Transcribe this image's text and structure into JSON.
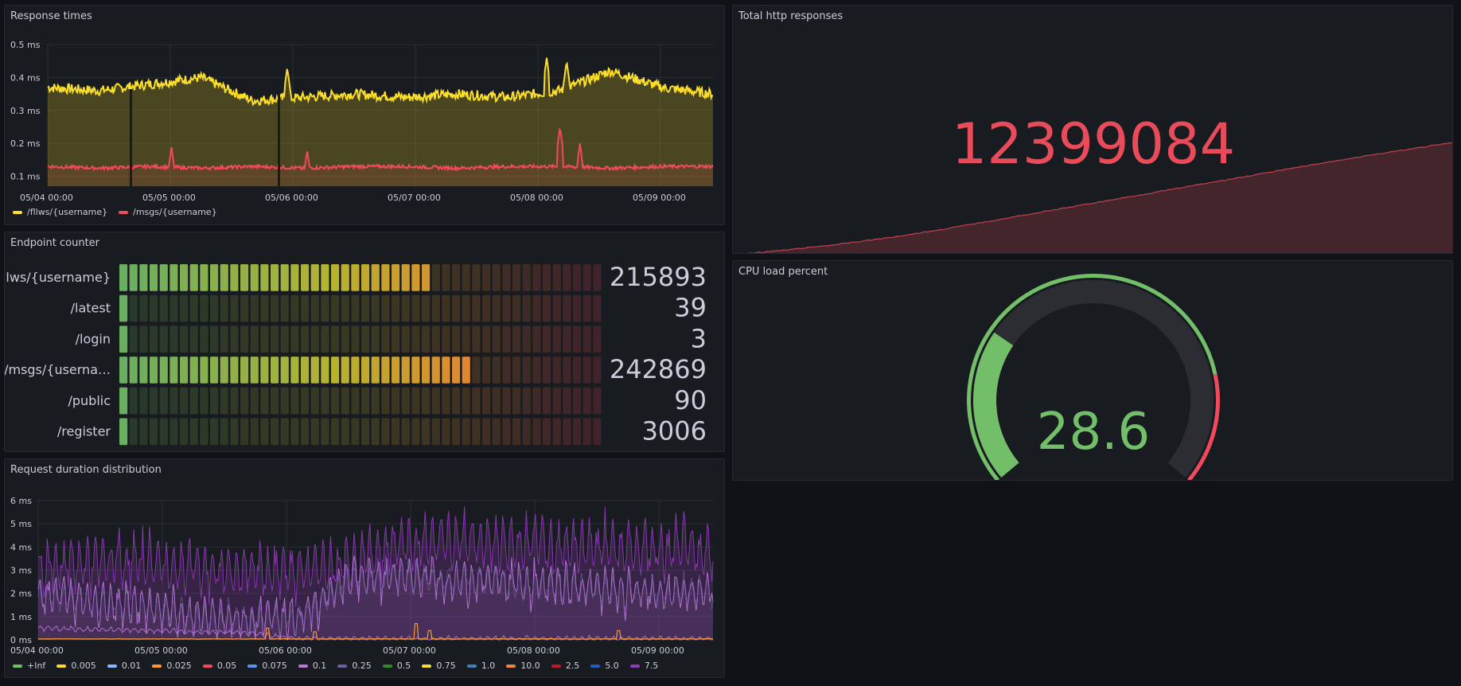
{
  "panels": {
    "response_times": {
      "title": "Response times"
    },
    "total_http": {
      "title": "Total http responses",
      "value": "12399084",
      "value_color": "#e84b5a"
    },
    "endpoint_counter": {
      "title": "Endpoint counter"
    },
    "cpu": {
      "title": "CPU load percent",
      "value": "28.6",
      "value_color": "#73bf69"
    },
    "request_duration": {
      "title": "Request duration distribution"
    }
  },
  "colors": {
    "green": "#73bf69",
    "yellow": "#fade2a",
    "red": "#f2495c",
    "orange": "#ff9830",
    "purple": "#b877d9"
  },
  "chart_data": [
    {
      "id": "response_times",
      "type": "area",
      "x_ticks": [
        "05/04 00:00",
        "05/05 00:00",
        "05/06 00:00",
        "05/07 00:00",
        "05/08 00:00",
        "05/09 00:00"
      ],
      "y_ticks": [
        "0.1 ms",
        "0.2 ms",
        "0.3 ms",
        "0.4 ms",
        "0.5 ms"
      ],
      "ylim": [
        0.07,
        0.5
      ],
      "series": [
        {
          "name": "/fllws/{username}",
          "color": "#fade2a",
          "baseline": [
            0.37,
            0.36,
            0.38,
            0.4,
            0.33,
            0.34,
            0.35,
            0.34,
            0.35,
            0.34,
            0.36,
            0.42,
            0.37,
            0.35
          ],
          "spikes": [
            [
              0.36,
              0.43
            ],
            [
              0.75,
              0.46
            ],
            [
              0.78,
              0.45
            ]
          ]
        },
        {
          "name": "/msgs/{username}",
          "color": "#f2495c",
          "baseline": [
            0.13,
            0.125,
            0.13,
            0.125,
            0.13,
            0.125,
            0.13,
            0.13,
            0.125,
            0.13,
            0.13,
            0.125,
            0.13,
            0.13
          ],
          "spikes": [
            [
              0.186,
              0.19
            ],
            [
              0.39,
              0.18
            ],
            [
              0.77,
              0.25
            ],
            [
              0.8,
              0.2
            ]
          ]
        }
      ],
      "grid": true
    },
    {
      "id": "total_http",
      "type": "area",
      "series": [
        {
          "name": "",
          "color": "#e84b5a",
          "values": [
            0.0,
            0.04,
            0.09,
            0.15,
            0.22,
            0.3,
            0.38,
            0.46,
            0.54,
            0.62,
            0.7,
            0.78,
            0.86,
            0.93,
            1.0
          ]
        }
      ]
    },
    {
      "id": "endpoint_counter",
      "type": "bar",
      "categories": [
        "/fllws/{username}",
        "/latest",
        "/login",
        "/msgs/{userna…",
        "/public",
        "/register"
      ],
      "values": [
        215893,
        39,
        3,
        242869,
        90,
        3006
      ],
      "value_labels": [
        "215893",
        "39",
        "3",
        "242869",
        "90",
        "3006"
      ],
      "value_colors": [
        "#f2964c",
        "#73bf69",
        "#73bf69",
        "#f37541",
        "#73bf69",
        "#73bf69"
      ],
      "max": 330000
    },
    {
      "id": "cpu",
      "type": "gauge",
      "value": 28.6,
      "min": 0,
      "max": 100,
      "thresholds": [
        {
          "color": "#73bf69",
          "from": 0
        },
        {
          "color": "#f2495c",
          "from": 80
        }
      ]
    },
    {
      "id": "request_duration",
      "type": "line",
      "x_ticks": [
        "05/04 00:00",
        "05/05 00:00",
        "05/06 00:00",
        "05/07 00:00",
        "05/08 00:00",
        "05/09 00:00"
      ],
      "y_ticks": [
        "0 ms",
        "1 ms",
        "2 ms",
        "3 ms",
        "4 ms",
        "5 ms",
        "6 ms"
      ],
      "ylim": [
        0,
        6
      ],
      "series": [
        {
          "name": "+Inf",
          "color": "#73bf69"
        },
        {
          "name": "0.005",
          "color": "#fade2a"
        },
        {
          "name": "0.01",
          "color": "#8ab8ff"
        },
        {
          "name": "0.025",
          "color": "#ff9830"
        },
        {
          "name": "0.05",
          "color": "#f2495c"
        },
        {
          "name": "0.075",
          "color": "#5794f2"
        },
        {
          "name": "0.1",
          "color": "#b877d9"
        },
        {
          "name": "0.25",
          "color": "#705da0"
        },
        {
          "name": "0.5",
          "color": "#37872d"
        },
        {
          "name": "0.75",
          "color": "#fade2a"
        },
        {
          "name": "1.0",
          "color": "#447ebc"
        },
        {
          "name": "10.0",
          "color": "#ef843c"
        },
        {
          "name": "2.5",
          "color": "#c4162a"
        },
        {
          "name": "5.0",
          "color": "#1f60c4"
        },
        {
          "name": "7.5",
          "color": "#8f3bb8"
        }
      ],
      "profile": {
        "outer": [
          3.2,
          3.3,
          3.4,
          3.1,
          3.0,
          3.0,
          3.3,
          4.2,
          4.3,
          4.2,
          4.0,
          4.1,
          3.9,
          4.0
        ],
        "inner": [
          2.0,
          1.7,
          1.5,
          1.0,
          0.9,
          0.9,
          2.6,
          2.8,
          2.6,
          2.5,
          2.3,
          2.2,
          2.0,
          2.1
        ],
        "low": [
          0.5,
          0.45,
          0.4,
          0.35,
          0.3,
          0.05,
          0.05,
          0.05,
          0.05,
          0.05,
          0.05,
          0.05,
          0.05,
          0.05
        ]
      }
    }
  ]
}
